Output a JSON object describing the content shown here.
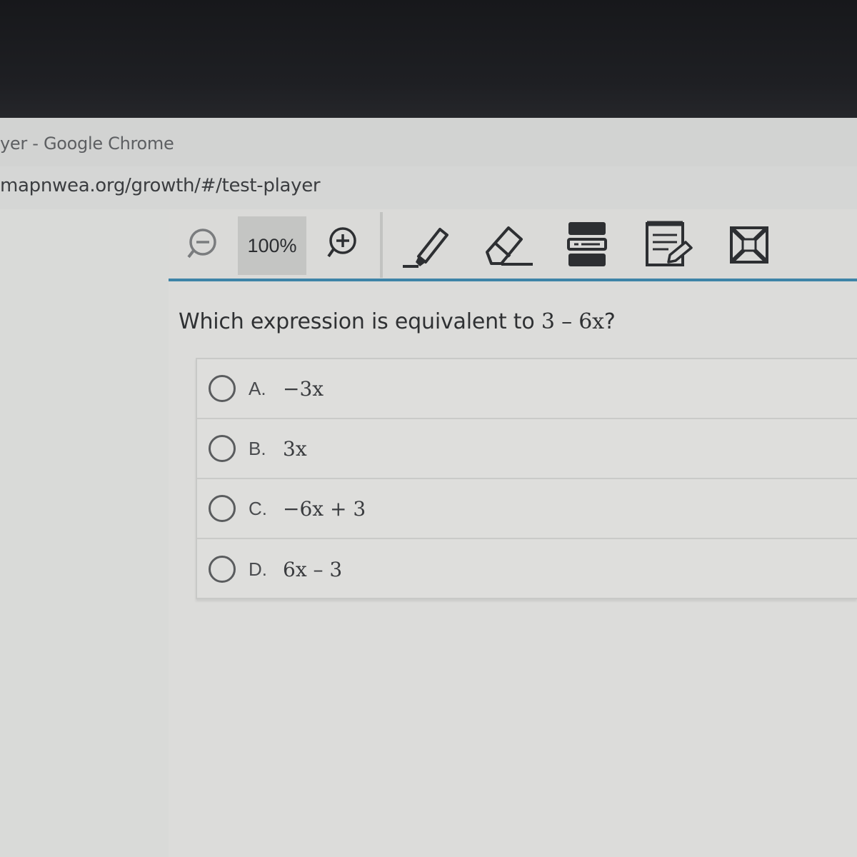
{
  "window": {
    "title": "yer - Google Chrome",
    "url": "mapnwea.org/growth/#/test-player"
  },
  "toolbar": {
    "zoom_out_icon": "zoom-out-icon",
    "zoom_level": "100%",
    "zoom_in_icon": "zoom-in-icon",
    "tools": [
      "highlighter-icon",
      "eraser-icon",
      "line-reader-icon",
      "notepad-icon",
      "answer-eliminator-icon"
    ],
    "accent_color": "#3e84a8"
  },
  "question": {
    "prompt": "Which expression is equivalent to ",
    "expression": "3 – 6x",
    "suffix": "?"
  },
  "choices": [
    {
      "letter": "A.",
      "expression": "−3x"
    },
    {
      "letter": "B.",
      "expression": "3x"
    },
    {
      "letter": "C.",
      "expression": "−6x + 3"
    },
    {
      "letter": "D.",
      "expression": "6x – 3"
    }
  ]
}
